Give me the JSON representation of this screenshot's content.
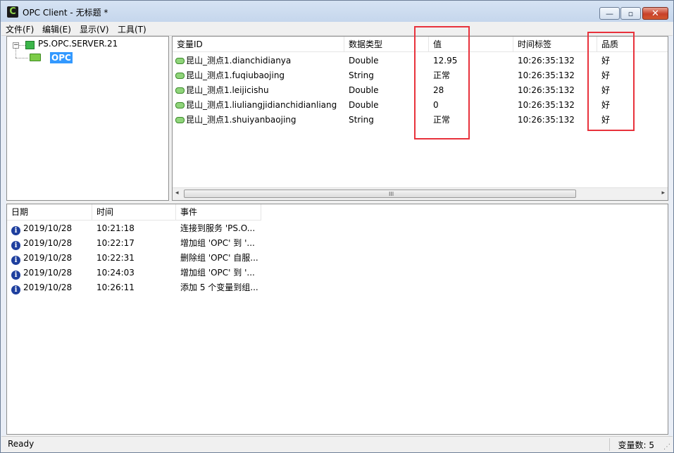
{
  "window": {
    "title": "OPC Client - 无标题 *",
    "icon_letter": "C",
    "buttons": {
      "minimize": "—",
      "maximize": "▫",
      "close": "✕"
    }
  },
  "menu": [
    "文件(F)",
    "编辑(E)",
    "显示(V)",
    "工具(T)"
  ],
  "tree": {
    "expander": "−",
    "server": "PS.OPC.SERVER.21",
    "group": "OPC"
  },
  "items": {
    "columns": [
      "变量ID",
      "数据类型",
      "值",
      "时间标签",
      "品质"
    ],
    "rows": [
      [
        "昆山_测点1.dianchidianya",
        "Double",
        "12.95",
        "10:26:35:132",
        "好"
      ],
      [
        "昆山_测点1.fuqiubaojing",
        "String",
        "正常",
        "10:26:35:132",
        "好"
      ],
      [
        "昆山_测点1.leijicishu",
        "Double",
        "28",
        "10:26:35:132",
        "好"
      ],
      [
        "昆山_测点1.liuliangjidianchidianliang",
        "Double",
        "0",
        "10:26:35:132",
        "好"
      ],
      [
        "昆山_测点1.shuiyanbaojing",
        "String",
        "正常",
        "10:26:35:132",
        "好"
      ]
    ],
    "scroll": {
      "left": "◂",
      "right": "▸",
      "grip": "III"
    }
  },
  "log": {
    "columns": [
      "日期",
      "时间",
      "事件"
    ],
    "icon": "i",
    "rows": [
      [
        "2019/10/28",
        "10:21:18",
        "连接到服务 'PS.O..."
      ],
      [
        "2019/10/28",
        "10:22:17",
        "增加组 'OPC' 到 '..."
      ],
      [
        "2019/10/28",
        "10:22:31",
        "删除组 'OPC' 自服..."
      ],
      [
        "2019/10/28",
        "10:24:03",
        "增加组 'OPC' 到 '..."
      ],
      [
        "2019/10/28",
        "10:26:11",
        "添加 5 个变量到组..."
      ]
    ]
  },
  "status": {
    "text": "Ready",
    "count": "变量数: 5"
  },
  "colors": {
    "highlight": "#e8323c",
    "selection": "#3399ff"
  }
}
